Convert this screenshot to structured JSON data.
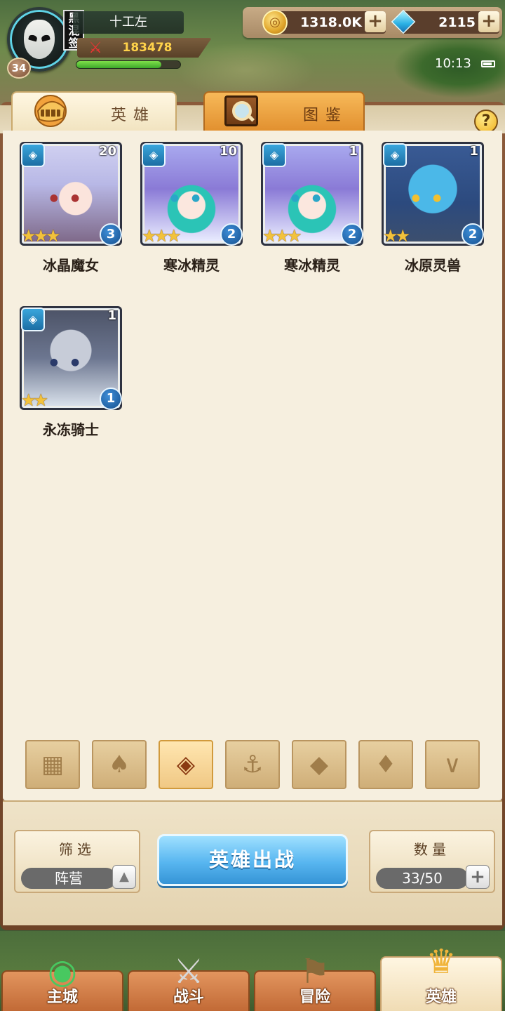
{
  "player": {
    "name": "十工左",
    "guild_tag": "黑\n混\n签",
    "level": "34",
    "power": "183478",
    "xp_fraction": 0.82
  },
  "currency": {
    "gold": "1318.0K",
    "gems": "2115",
    "plus": "+"
  },
  "status": {
    "time": "10:13"
  },
  "tabs": {
    "heroes": "英雄",
    "codex": "图鉴",
    "help": "?"
  },
  "heroes": [
    {
      "name": "冰晶魔女",
      "count": "20",
      "level": "3",
      "stars": "★★★",
      "faction_icon": "ice-faction-icon"
    },
    {
      "name": "寒冰精灵",
      "count": "10",
      "level": "2",
      "stars": "★★★",
      "faction_icon": "ice-faction-icon"
    },
    {
      "name": "寒冰精灵",
      "count": "1",
      "level": "2",
      "stars": "★★★",
      "faction_icon": "ice-faction-icon"
    },
    {
      "name": "冰原灵兽",
      "count": "1",
      "level": "2",
      "stars": "★★",
      "faction_icon": "ice-faction-icon"
    },
    {
      "name": "永冻骑士",
      "count": "1",
      "level": "1",
      "stars": "★★",
      "faction_icon": "ice-faction-icon"
    }
  ],
  "faction_filters": [
    {
      "icon": "all-grid-icon",
      "glyph": "▦",
      "active": false
    },
    {
      "icon": "nature-leaf-icon",
      "glyph": "♠",
      "active": false
    },
    {
      "icon": "ice-faction-icon",
      "glyph": "◈",
      "active": true
    },
    {
      "icon": "anchor-icon",
      "glyph": "⚓",
      "active": false
    },
    {
      "icon": "beast-head-icon",
      "glyph": "◆",
      "active": false
    },
    {
      "icon": "demon-horns-icon",
      "glyph": "♦",
      "active": false
    },
    {
      "icon": "wings-icon",
      "glyph": "∨",
      "active": false
    }
  ],
  "controls": {
    "filter_title": "筛选",
    "filter_value": "阵营",
    "deploy_label": "英雄出战",
    "quantity_title": "数量",
    "quantity_value": "33/50"
  },
  "nav": [
    {
      "label": "主城",
      "icon": "castle-icon",
      "active": false
    },
    {
      "label": "战斗",
      "icon": "crossed-swords-icon",
      "active": false
    },
    {
      "label": "冒险",
      "icon": "map-scroll-icon",
      "active": false
    },
    {
      "label": "英雄",
      "icon": "hero-crest-icon",
      "active": true
    }
  ],
  "colors": {
    "accent_orange": "#e18f2e",
    "deploy_blue": "#58b6f0",
    "panel_bg": "#f6efdf",
    "hero_name": "#2a2018"
  }
}
